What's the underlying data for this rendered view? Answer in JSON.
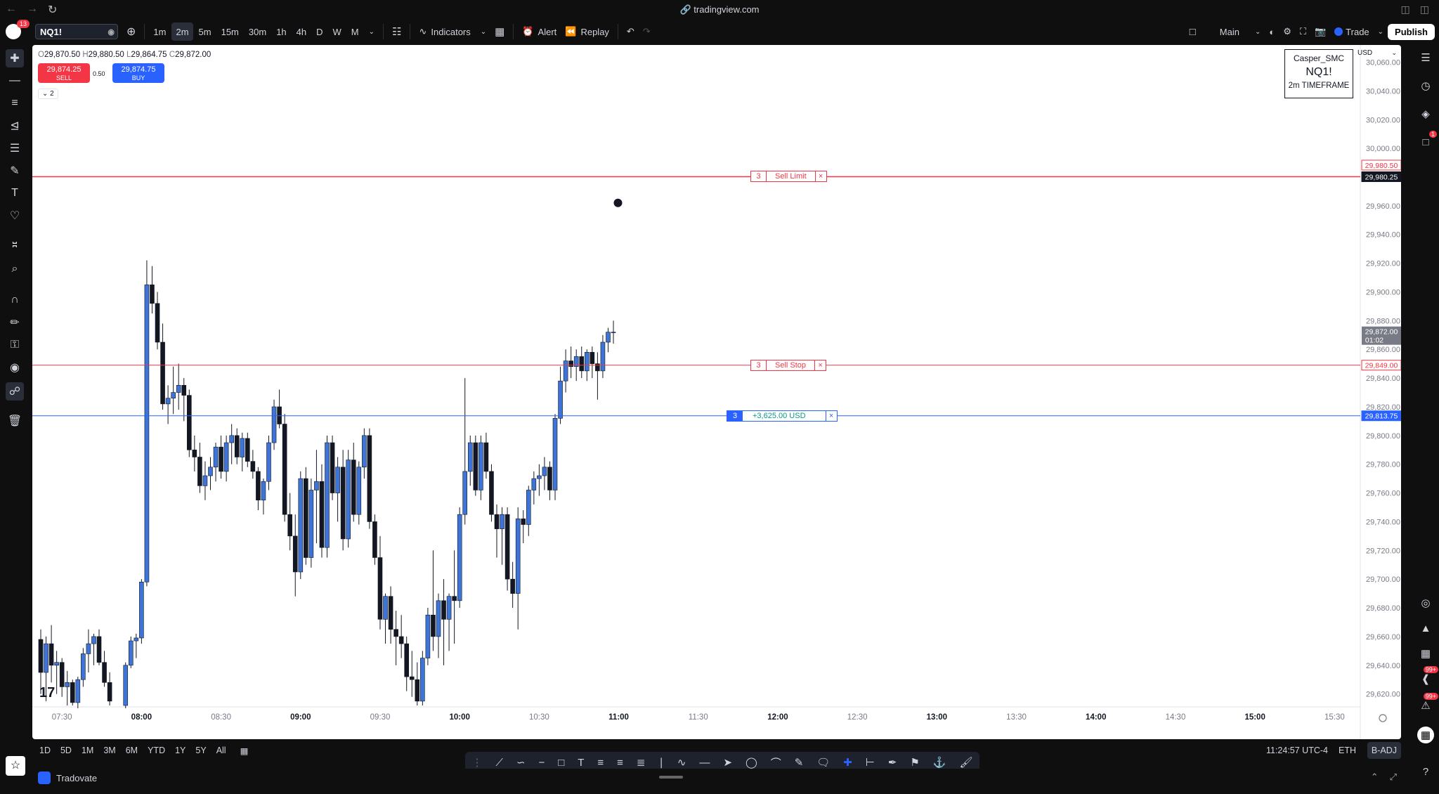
{
  "browser": {
    "url": "tradingview.com"
  },
  "toolbar": {
    "notification_count": "13",
    "symbol": "NQ1!",
    "intervals": [
      "1m",
      "2m",
      "5m",
      "15m",
      "30m",
      "1h",
      "4h",
      "D",
      "W",
      "M"
    ],
    "active_interval": "2m",
    "indicators_label": "Indicators",
    "alert_label": "Alert",
    "replay_label": "Replay",
    "layout_label": "Main",
    "trade_label": "Trade",
    "publish_label": "Publish"
  },
  "legend": {
    "o_key": "O",
    "o": "29,870.50",
    "h_key": "H",
    "h": "29,880.50",
    "l_key": "L",
    "l": "29,864.75",
    "c_key": "C",
    "c": "29,872.00",
    "sell_price": "29,874.25",
    "sell_label": "SELL",
    "buy_price": "29,874.75",
    "buy_label": "BUY",
    "spread": "0.50",
    "collapse_count": "2"
  },
  "infobox": {
    "line1": "Casper_SMC",
    "line2": "NQ1!",
    "line3": "2m TIMEFRAME"
  },
  "currency": "USD",
  "orders": [
    {
      "qty": "3",
      "label": "Sell Limit",
      "price": 29980.25,
      "price_label": "29,980.25",
      "color": "#f23645",
      "type": "limit"
    },
    {
      "qty": "3",
      "label": "Sell Stop",
      "price": 29849.0,
      "price_label": "29,849.00",
      "color": "#f23645",
      "type": "stop"
    },
    {
      "qty": "3",
      "label": "+3,625.00 USD",
      "price": 29813.75,
      "price_label": "29,813.75",
      "color": "#2962ff",
      "type": "position"
    }
  ],
  "ask_line": {
    "price": 29980.5,
    "label": "29,980.50"
  },
  "last_price": {
    "price": 29872.0,
    "label": "29,872.00",
    "countdown": "01:02"
  },
  "colors": {
    "up": "#3d74d6",
    "down": "#131722",
    "sell": "#f23645",
    "buy": "#2962ff"
  },
  "chart_data": {
    "type": "candlestick",
    "symbol": "NQ1!",
    "interval": "2m",
    "ylim": [
      29612,
      30072
    ],
    "y_ticks": [
      29620,
      29640,
      29660,
      29680,
      29700,
      29720,
      29740,
      29760,
      29780,
      29800,
      29820,
      29840,
      29860,
      29880,
      29900,
      29920,
      29940,
      29960,
      30000,
      30020,
      30040,
      30060
    ],
    "y_tick_labels": [
      "29,620.00",
      "29,640.00",
      "29,660.00",
      "29,680.00",
      "29,700.00",
      "29,720.00",
      "29,740.00",
      "29,760.00",
      "29,780.00",
      "29,800.00",
      "29,820.00",
      "29,840.00",
      "29,860.00",
      "29,880.00",
      "29,900.00",
      "29,920.00",
      "29,940.00",
      "29,960.00",
      "30,000.00",
      "30,020.00",
      "30,040.00",
      "30,060.00"
    ],
    "x_labels": [
      "07:30",
      "08:00",
      "08:30",
      "09:00",
      "09:30",
      "10:00",
      "10:30",
      "11:00",
      "11:30",
      "12:00",
      "12:30",
      "13:00",
      "13:30",
      "14:00",
      "14:30",
      "15:00",
      "15:30"
    ],
    "x_range_minutes": [
      442,
      936
    ],
    "candles": [
      {
        "t": 442,
        "o": 29658,
        "h": 29665,
        "l": 29620,
        "c": 29635
      },
      {
        "t": 444,
        "o": 29635,
        "h": 29660,
        "l": 29615,
        "c": 29655
      },
      {
        "t": 446,
        "o": 29655,
        "h": 29668,
        "l": 29628,
        "c": 29640
      },
      {
        "t": 448,
        "o": 29640,
        "h": 29650,
        "l": 29620,
        "c": 29642
      },
      {
        "t": 450,
        "o": 29642,
        "h": 29645,
        "l": 29618,
        "c": 29625
      },
      {
        "t": 452,
        "o": 29625,
        "h": 29636,
        "l": 29612,
        "c": 29628
      },
      {
        "t": 454,
        "o": 29628,
        "h": 29630,
        "l": 29612,
        "c": 29614
      },
      {
        "t": 456,
        "o": 29614,
        "h": 29632,
        "l": 29610,
        "c": 29630
      },
      {
        "t": 458,
        "o": 29630,
        "h": 29652,
        "l": 29625,
        "c": 29648
      },
      {
        "t": 460,
        "o": 29648,
        "h": 29665,
        "l": 29635,
        "c": 29655
      },
      {
        "t": 462,
        "o": 29655,
        "h": 29662,
        "l": 29640,
        "c": 29660
      },
      {
        "t": 464,
        "o": 29660,
        "h": 29665,
        "l": 29640,
        "c": 29642
      },
      {
        "t": 466,
        "o": 29642,
        "h": 29650,
        "l": 29625,
        "c": 29628
      },
      {
        "t": 468,
        "o": 29628,
        "h": 29635,
        "l": 29612,
        "c": 29615
      },
      {
        "t": 474,
        "o": 29612,
        "h": 29642,
        "l": 29610,
        "c": 29640
      },
      {
        "t": 476,
        "o": 29640,
        "h": 29660,
        "l": 29638,
        "c": 29657
      },
      {
        "t": 478,
        "o": 29657,
        "h": 29662,
        "l": 29645,
        "c": 29659
      },
      {
        "t": 480,
        "o": 29659,
        "h": 29700,
        "l": 29655,
        "c": 29698
      },
      {
        "t": 482,
        "o": 29698,
        "h": 29922,
        "l": 29695,
        "c": 29905
      },
      {
        "t": 484,
        "o": 29905,
        "h": 29918,
        "l": 29885,
        "c": 29892
      },
      {
        "t": 486,
        "o": 29892,
        "h": 29900,
        "l": 29860,
        "c": 29865
      },
      {
        "t": 488,
        "o": 29865,
        "h": 29878,
        "l": 29818,
        "c": 29822
      },
      {
        "t": 490,
        "o": 29822,
        "h": 29835,
        "l": 29808,
        "c": 29826
      },
      {
        "t": 492,
        "o": 29826,
        "h": 29848,
        "l": 29815,
        "c": 29830
      },
      {
        "t": 494,
        "o": 29830,
        "h": 29850,
        "l": 29818,
        "c": 29835
      },
      {
        "t": 496,
        "o": 29835,
        "h": 29840,
        "l": 29810,
        "c": 29828
      },
      {
        "t": 498,
        "o": 29828,
        "h": 29832,
        "l": 29785,
        "c": 29790
      },
      {
        "t": 500,
        "o": 29790,
        "h": 29800,
        "l": 29775,
        "c": 29785
      },
      {
        "t": 502,
        "o": 29785,
        "h": 29795,
        "l": 29760,
        "c": 29765
      },
      {
        "t": 504,
        "o": 29765,
        "h": 29782,
        "l": 29755,
        "c": 29772
      },
      {
        "t": 506,
        "o": 29772,
        "h": 29785,
        "l": 29762,
        "c": 29778
      },
      {
        "t": 508,
        "o": 29778,
        "h": 29795,
        "l": 29768,
        "c": 29792
      },
      {
        "t": 510,
        "o": 29792,
        "h": 29800,
        "l": 29770,
        "c": 29775
      },
      {
        "t": 512,
        "o": 29775,
        "h": 29800,
        "l": 29768,
        "c": 29795
      },
      {
        "t": 514,
        "o": 29795,
        "h": 29808,
        "l": 29780,
        "c": 29800
      },
      {
        "t": 516,
        "o": 29800,
        "h": 29805,
        "l": 29780,
        "c": 29785
      },
      {
        "t": 518,
        "o": 29785,
        "h": 29802,
        "l": 29775,
        "c": 29798
      },
      {
        "t": 520,
        "o": 29798,
        "h": 29802,
        "l": 29778,
        "c": 29782
      },
      {
        "t": 522,
        "o": 29782,
        "h": 29790,
        "l": 29770,
        "c": 29775
      },
      {
        "t": 524,
        "o": 29775,
        "h": 29778,
        "l": 29748,
        "c": 29755
      },
      {
        "t": 526,
        "o": 29755,
        "h": 29770,
        "l": 29745,
        "c": 29768
      },
      {
        "t": 528,
        "o": 29768,
        "h": 29800,
        "l": 29762,
        "c": 29795
      },
      {
        "t": 530,
        "o": 29795,
        "h": 29825,
        "l": 29790,
        "c": 29820
      },
      {
        "t": 532,
        "o": 29820,
        "h": 29832,
        "l": 29805,
        "c": 29808
      },
      {
        "t": 534,
        "o": 29808,
        "h": 29815,
        "l": 29740,
        "c": 29745
      },
      {
        "t": 536,
        "o": 29745,
        "h": 29760,
        "l": 29720,
        "c": 29730
      },
      {
        "t": 538,
        "o": 29730,
        "h": 29745,
        "l": 29688,
        "c": 29705
      },
      {
        "t": 540,
        "o": 29705,
        "h": 29775,
        "l": 29700,
        "c": 29770
      },
      {
        "t": 542,
        "o": 29770,
        "h": 29778,
        "l": 29710,
        "c": 29715
      },
      {
        "t": 544,
        "o": 29715,
        "h": 29770,
        "l": 29708,
        "c": 29762
      },
      {
        "t": 546,
        "o": 29762,
        "h": 29790,
        "l": 29725,
        "c": 29768
      },
      {
        "t": 548,
        "o": 29768,
        "h": 29780,
        "l": 29715,
        "c": 29722
      },
      {
        "t": 550,
        "o": 29722,
        "h": 29800,
        "l": 29715,
        "c": 29795
      },
      {
        "t": 552,
        "o": 29795,
        "h": 29800,
        "l": 29755,
        "c": 29760
      },
      {
        "t": 554,
        "o": 29760,
        "h": 29785,
        "l": 29740,
        "c": 29778
      },
      {
        "t": 556,
        "o": 29778,
        "h": 29790,
        "l": 29720,
        "c": 29728
      },
      {
        "t": 558,
        "o": 29728,
        "h": 29790,
        "l": 29722,
        "c": 29783
      },
      {
        "t": 560,
        "o": 29783,
        "h": 29795,
        "l": 29740,
        "c": 29745
      },
      {
        "t": 562,
        "o": 29745,
        "h": 29782,
        "l": 29738,
        "c": 29778
      },
      {
        "t": 564,
        "o": 29778,
        "h": 29805,
        "l": 29770,
        "c": 29800
      },
      {
        "t": 566,
        "o": 29800,
        "h": 29805,
        "l": 29735,
        "c": 29740
      },
      {
        "t": 568,
        "o": 29740,
        "h": 29745,
        "l": 29710,
        "c": 29715
      },
      {
        "t": 570,
        "o": 29715,
        "h": 29730,
        "l": 29665,
        "c": 29672
      },
      {
        "t": 572,
        "o": 29672,
        "h": 29690,
        "l": 29655,
        "c": 29688
      },
      {
        "t": 574,
        "o": 29688,
        "h": 29695,
        "l": 29655,
        "c": 29665
      },
      {
        "t": 576,
        "o": 29665,
        "h": 29678,
        "l": 29640,
        "c": 29660
      },
      {
        "t": 578,
        "o": 29660,
        "h": 29675,
        "l": 29645,
        "c": 29655
      },
      {
        "t": 580,
        "o": 29655,
        "h": 29660,
        "l": 29622,
        "c": 29632
      },
      {
        "t": 582,
        "o": 29632,
        "h": 29650,
        "l": 29618,
        "c": 29630
      },
      {
        "t": 584,
        "o": 29630,
        "h": 29642,
        "l": 29612,
        "c": 29615
      },
      {
        "t": 586,
        "o": 29615,
        "h": 29650,
        "l": 29612,
        "c": 29645
      },
      {
        "t": 588,
        "o": 29645,
        "h": 29680,
        "l": 29640,
        "c": 29675
      },
      {
        "t": 590,
        "o": 29675,
        "h": 29720,
        "l": 29650,
        "c": 29660
      },
      {
        "t": 592,
        "o": 29660,
        "h": 29690,
        "l": 29645,
        "c": 29685
      },
      {
        "t": 594,
        "o": 29685,
        "h": 29700,
        "l": 29640,
        "c": 29672
      },
      {
        "t": 596,
        "o": 29672,
        "h": 29690,
        "l": 29650,
        "c": 29688
      },
      {
        "t": 598,
        "o": 29688,
        "h": 29720,
        "l": 29655,
        "c": 29685
      },
      {
        "t": 600,
        "o": 29685,
        "h": 29750,
        "l": 29680,
        "c": 29745
      },
      {
        "t": 602,
        "o": 29745,
        "h": 29840,
        "l": 29738,
        "c": 29775
      },
      {
        "t": 604,
        "o": 29775,
        "h": 29800,
        "l": 29765,
        "c": 29795
      },
      {
        "t": 606,
        "o": 29795,
        "h": 29800,
        "l": 29758,
        "c": 29762
      },
      {
        "t": 608,
        "o": 29762,
        "h": 29800,
        "l": 29755,
        "c": 29795
      },
      {
        "t": 610,
        "o": 29795,
        "h": 29802,
        "l": 29770,
        "c": 29775
      },
      {
        "t": 612,
        "o": 29775,
        "h": 29780,
        "l": 29740,
        "c": 29745
      },
      {
        "t": 614,
        "o": 29745,
        "h": 29752,
        "l": 29715,
        "c": 29735
      },
      {
        "t": 616,
        "o": 29735,
        "h": 29750,
        "l": 29710,
        "c": 29745
      },
      {
        "t": 618,
        "o": 29745,
        "h": 29750,
        "l": 29692,
        "c": 29700
      },
      {
        "t": 620,
        "o": 29700,
        "h": 29712,
        "l": 29680,
        "c": 29690
      },
      {
        "t": 622,
        "o": 29690,
        "h": 29750,
        "l": 29665,
        "c": 29742
      },
      {
        "t": 624,
        "o": 29742,
        "h": 29748,
        "l": 29725,
        "c": 29738
      },
      {
        "t": 626,
        "o": 29738,
        "h": 29765,
        "l": 29730,
        "c": 29762
      },
      {
        "t": 628,
        "o": 29762,
        "h": 29775,
        "l": 29752,
        "c": 29770
      },
      {
        "t": 630,
        "o": 29770,
        "h": 29780,
        "l": 29758,
        "c": 29772
      },
      {
        "t": 632,
        "o": 29772,
        "h": 29785,
        "l": 29762,
        "c": 29778
      },
      {
        "t": 634,
        "o": 29778,
        "h": 29782,
        "l": 29755,
        "c": 29762
      },
      {
        "t": 636,
        "o": 29762,
        "h": 29815,
        "l": 29755,
        "c": 29812
      },
      {
        "t": 638,
        "o": 29812,
        "h": 29848,
        "l": 29808,
        "c": 29838
      },
      {
        "t": 640,
        "o": 29838,
        "h": 29860,
        "l": 29830,
        "c": 29852
      },
      {
        "t": 642,
        "o": 29852,
        "h": 29862,
        "l": 29840,
        "c": 29848
      },
      {
        "t": 644,
        "o": 29848,
        "h": 29860,
        "l": 29838,
        "c": 29855
      },
      {
        "t": 646,
        "o": 29855,
        "h": 29862,
        "l": 29840,
        "c": 29845
      },
      {
        "t": 648,
        "o": 29845,
        "h": 29860,
        "l": 29838,
        "c": 29858
      },
      {
        "t": 650,
        "o": 29858,
        "h": 29862,
        "l": 29840,
        "c": 29850
      },
      {
        "t": 652,
        "o": 29850,
        "h": 29858,
        "l": 29825,
        "c": 29845
      },
      {
        "t": 654,
        "o": 29845,
        "h": 29870,
        "l": 29840,
        "c": 29865
      },
      {
        "t": 656,
        "o": 29865,
        "h": 29875,
        "l": 29858,
        "c": 29872
      },
      {
        "t": 658,
        "o": 29872,
        "h": 29880,
        "l": 29864,
        "c": 29872
      }
    ]
  },
  "bottom": {
    "ranges": [
      "1D",
      "5D",
      "1M",
      "3M",
      "6M",
      "YTD",
      "1Y",
      "5Y",
      "All"
    ],
    "clock": "11:24:57 UTC-4",
    "session": "ETH",
    "adj": "B-ADJ"
  },
  "panel": {
    "broker": "Tradovate"
  },
  "sidebar_badges": {
    "chat": "1",
    "b1": "99+",
    "b2": "99+"
  }
}
